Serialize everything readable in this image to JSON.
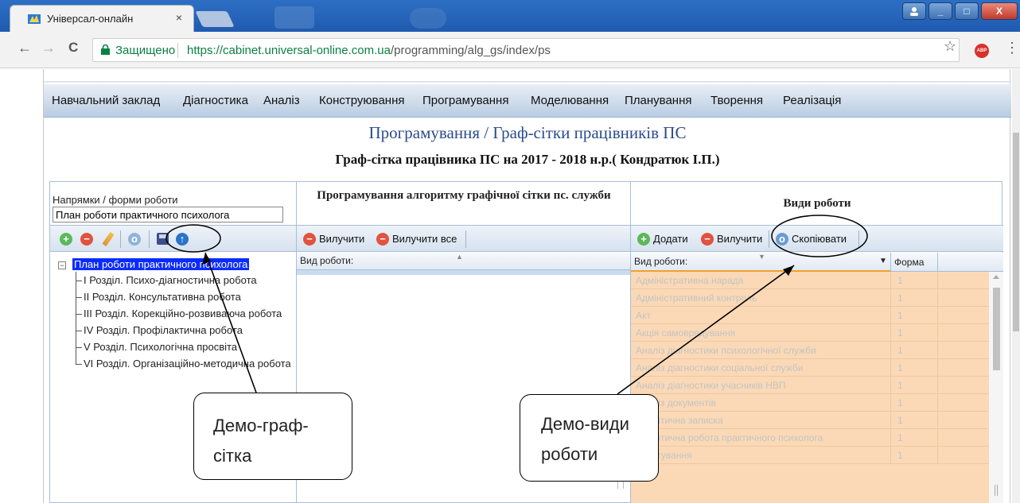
{
  "browser": {
    "tab_title": "Універсал-онлайн",
    "tab_close": "×",
    "back_icon": "←",
    "forward_icon": "→",
    "reload_icon": "C",
    "secure_label": "Защищено",
    "url_host": "https://cabinet.universal-online.com.ua",
    "url_path": "/programming/alg_gs/index/ps",
    "star_icon": "☆",
    "abp_label": "ABP",
    "menu_icon": "⋮",
    "window_buttons": {
      "minimize": "_",
      "maximize": "□",
      "close": "X"
    }
  },
  "menu": [
    "Навчальний заклад",
    "Діагностика",
    "Аналіз",
    "Конструювання",
    "Програмування",
    "Моделювання",
    "Планування",
    "Творення",
    "Реалізація"
  ],
  "page": {
    "heading": "Програмування / Граф-сітки працівників ПС",
    "subheading": "Граф-сітка працівника ПС на 2017 - 2018 н.р.( Кондратюк І.П.)"
  },
  "left_panel": {
    "label": "Напрямки / форми роботи",
    "input_value": "План роботи практичного психолога",
    "tree_root": "План роботи практичного психолога",
    "tree_toggle": "−",
    "tree_children": [
      "І Розділ. Психо-діагностична робота",
      "ІІ Розділ. Консультативна робота",
      "ІІІ Розділ. Корекційно-розвиваюча робота",
      "IV Розділ. Профілактична робота",
      "V Розділ. Психологічна просвіта",
      "VI Розділ. Організаційно-методична робота"
    ]
  },
  "middle_panel": {
    "title": "Програмування алгоритму графічної сітки пс. служби",
    "remove_label": "Вилучити",
    "remove_all_label": "Вилучити все",
    "column_header": "Вид роботи:"
  },
  "right_panel": {
    "title": "Види роботи",
    "add_label": "Додати",
    "remove_label": "Вилучити",
    "copy_label": "Скопіювати",
    "col_name": "Вид роботи:",
    "col_form": "Форма",
    "rows": [
      {
        "name": "Адміністративна нарада",
        "form": "1"
      },
      {
        "name": "Адміністративний контроль",
        "form": "1"
      },
      {
        "name": "Акт",
        "form": "1"
      },
      {
        "name": "Акція самоврядування",
        "form": "1"
      },
      {
        "name": "Аналіз діагностики психологічної служби",
        "form": "1"
      },
      {
        "name": "Аналіз діагностики соціальної служби",
        "form": "1"
      },
      {
        "name": "Аналіз діагностики учасників НВП",
        "form": "1"
      },
      {
        "name": "Аналіз документів",
        "form": "1"
      },
      {
        "name": "Аналітична записка",
        "form": "1"
      },
      {
        "name": "Аналітична робота практичного психолога",
        "form": "1"
      },
      {
        "name": "Анкетування",
        "form": "1"
      }
    ]
  },
  "annotations": {
    "callout_left": [
      "Демо-граф-",
      "сітка"
    ],
    "callout_right": [
      "Демо-види",
      "роботи"
    ]
  }
}
